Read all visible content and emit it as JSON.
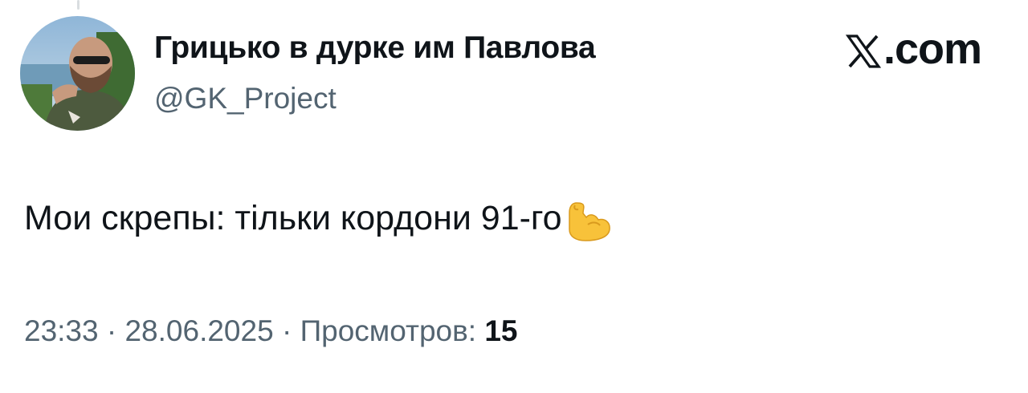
{
  "author": {
    "display_name": "Грицько в дурке им Павлова",
    "handle": "@GK_Project",
    "avatar_icon": "avatar-photo"
  },
  "brand": {
    "text": ".com",
    "icon": "x-logo-icon"
  },
  "tweet": {
    "text": "Мои скрепы: тільки кордони 91-го",
    "emoji": "flexed-biceps-icon"
  },
  "meta": {
    "time": "23:33",
    "separator": "·",
    "date": "28.06.2025",
    "views_label": "Просмотров:",
    "views_count": "15"
  },
  "colors": {
    "text_primary": "#0f1419",
    "text_secondary": "#536471",
    "background": "#ffffff"
  }
}
